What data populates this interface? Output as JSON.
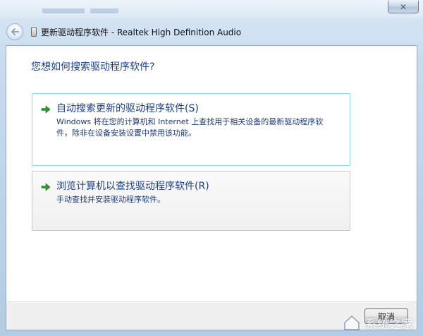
{
  "window": {
    "title": "更新驱动程序软件 - Realtek High Definition Audio",
    "close_label": "✕"
  },
  "page": {
    "heading": "您想如何搜索驱动程序软件?"
  },
  "options": [
    {
      "title": "自动搜索更新的驱动程序软件(S)",
      "description": "Windows 将在您的计算机和 Internet 上查找用于相关设备的最新驱动程序软件，除非在设备安装设置中禁用该功能。"
    },
    {
      "title": "浏览计算机以查找驱动程序软件(R)",
      "description": "手动查找并安装驱动程序软件。"
    }
  ],
  "footer": {
    "cancel_label": "取消"
  },
  "watermark": {
    "text": "系统之家"
  },
  "colors": {
    "heading_blue": "#1a3e8c",
    "arrow_green": "#2f9a2f",
    "hover_border": "#8ed6ec"
  },
  "icons": {
    "back": "back-arrow-icon",
    "option_arrow": "green-arrow-icon",
    "device": "device-icon"
  }
}
